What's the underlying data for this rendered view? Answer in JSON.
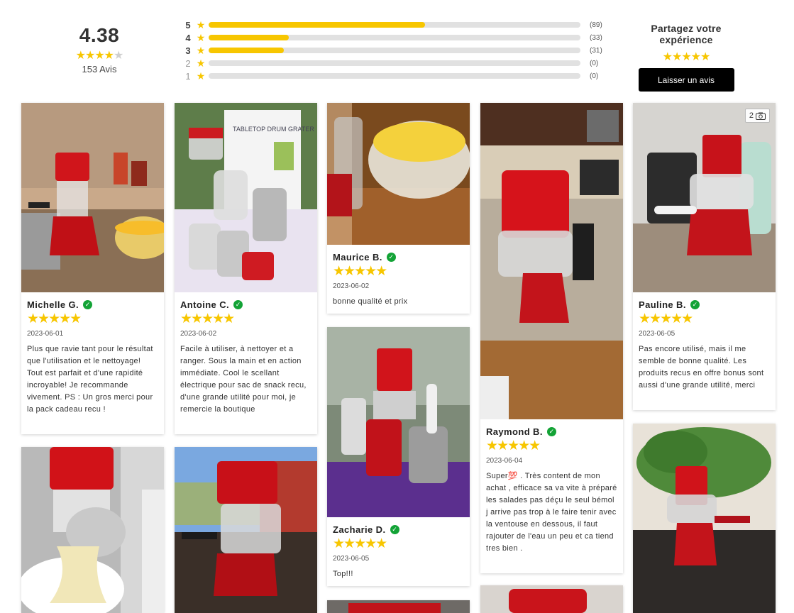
{
  "summary": {
    "average": "4.38",
    "average_value": 4.38,
    "reviews_count": "153 Avis",
    "distribution": [
      {
        "star": "5",
        "count": "(89)",
        "value": 89
      },
      {
        "star": "4",
        "count": "(33)",
        "value": 33
      },
      {
        "star": "3",
        "count": "(31)",
        "value": 31
      },
      {
        "star": "2",
        "count": "(0)",
        "value": 0
      },
      {
        "star": "1",
        "count": "(0)",
        "value": 0
      }
    ],
    "share_title": "Partagez votre expérience",
    "share_button": "Laisser un avis"
  },
  "colors": {
    "star": "#f7c600",
    "star_off": "#cfcfcf",
    "verified": "#13a336",
    "button": "#000000"
  },
  "reviews": [
    {
      "name": "Michelle G.",
      "date": "2023-06-01",
      "rating": 5,
      "text": "Plus que ravie tant pour le résultat que l'utilisation et le nettoyage! Tout est parfait et d'une rapidité incroyable! Je recommande vivement. PS : Un gros merci pour la pack cadeau recu !"
    },
    {
      "name": "Antoine C.",
      "date": "2023-06-02",
      "rating": 5,
      "text": "Facile à utiliser, à nettoyer et a ranger. Sous la main et en action immédiate. Cool le scellant\n électrique pour sac de snack recu, d'une grande utilité pour moi, je remercie la boutique"
    },
    {
      "name": "Maurice B.",
      "date": "2023-06-02",
      "rating": 5,
      "text": "bonne qualité et prix"
    },
    {
      "name": "Zacharie D.",
      "date": "2023-06-05",
      "rating": 5,
      "text": "Top!!!"
    },
    {
      "name": "Raymond B.",
      "date": "2023-06-04",
      "rating": 5,
      "text": "Super💯 . Très content de mon achat , efficace sa va vite à préparé les salades pas déçu le seul bémol j arrive pas trop à le faire tenir avec la ventouse en dessous, il faut rajouter de l'eau un peu et ca tiend tres bien ."
    },
    {
      "name": "Pauline B.",
      "date": "2023-06-05",
      "rating": 5,
      "photo_count": "2",
      "text": "Pas encore utilisé, mais il me semble de bonne qualité. Les produits recus en offre bonus sont aussi d'une grande utilité, merci"
    }
  ]
}
